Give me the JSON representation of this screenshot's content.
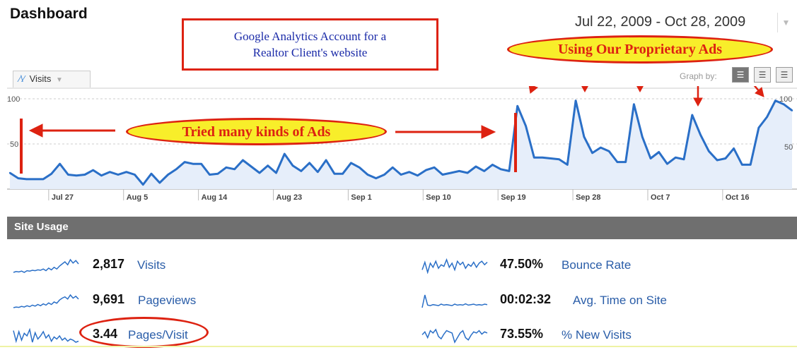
{
  "dashboard": {
    "title": "Dashboard",
    "date_range": "Jul 22, 2009 - Oct 28, 2009"
  },
  "annotations": {
    "callout_line1": "Google Analytics Account for a",
    "callout_line2": "Realtor Client's website",
    "ads_label": "Using Our Proprietary Ads",
    "tried_label": "Tried many kinds of Ads"
  },
  "graph": {
    "metric_tab": "Visits",
    "tab_icon": "line-chart-icon",
    "graph_by_label": "Graph by:",
    "graph_by_icons": [
      "day-icon",
      "week-icon",
      "month-icon"
    ],
    "y_max_label": "100",
    "y_mid_label": "50",
    "x_labels": [
      "Jul 27",
      "Aug 5",
      "Aug 14",
      "Aug 23",
      "Sep 1",
      "Sep 10",
      "Sep 19",
      "Sep 28",
      "Oct 7",
      "Oct 16"
    ]
  },
  "chart_data": {
    "type": "area",
    "series": [
      {
        "name": "Visits",
        "values": [
          18,
          12,
          11,
          11,
          11,
          17,
          28,
          16,
          15,
          16,
          21,
          15,
          19,
          16,
          19,
          16,
          5,
          17,
          7,
          16,
          22,
          30,
          28,
          28,
          16,
          17,
          24,
          22,
          32,
          25,
          18,
          26,
          18,
          39,
          26,
          20,
          29,
          19,
          32,
          17,
          17,
          29,
          24,
          16,
          12,
          16,
          24,
          16,
          19,
          15,
          21,
          24,
          16,
          18,
          20,
          18,
          25,
          20,
          27,
          22,
          20,
          92,
          70,
          35,
          35,
          34,
          33,
          27,
          98,
          58,
          40,
          46,
          42,
          30,
          30,
          94,
          58,
          34,
          41,
          28,
          35,
          33,
          82,
          60,
          42,
          32,
          34,
          45,
          27,
          27,
          68,
          80,
          98,
          94,
          87
        ],
        "color": "#2a6fc7",
        "fill": "#e6eefa"
      }
    ],
    "ylim": [
      0,
      100
    ],
    "grid": "horizontal dashed at 50 and 100"
  },
  "site_usage": {
    "header": "Site Usage",
    "metrics": [
      {
        "value": "2,817",
        "label": "Visits"
      },
      {
        "value": "9,691",
        "label": "Pageviews"
      },
      {
        "value": "3.44",
        "label": "Pages/Visit"
      },
      {
        "value": "47.50%",
        "label": "Bounce Rate"
      },
      {
        "value": "00:02:32",
        "label": "Avg. Time on Site"
      },
      {
        "value": "73.55%",
        "label": "% New Visits"
      }
    ],
    "sparklines": [
      [
        30,
        32,
        31,
        33,
        30,
        34,
        33,
        35,
        34,
        36,
        35,
        38,
        34,
        40,
        36,
        42,
        38,
        45,
        50,
        55,
        48,
        60,
        52,
        58,
        50
      ],
      [
        28,
        30,
        29,
        32,
        30,
        34,
        31,
        36,
        33,
        38,
        34,
        40,
        36,
        43,
        38,
        46,
        42,
        52,
        58,
        62,
        55,
        68,
        58,
        64,
        55
      ],
      [
        60,
        40,
        58,
        42,
        55,
        50,
        62,
        38,
        56,
        44,
        50,
        58,
        46,
        52,
        40,
        48,
        44,
        50,
        42,
        46,
        40,
        44,
        42,
        38,
        40
      ],
      [
        45,
        60,
        40,
        58,
        50,
        62,
        48,
        55,
        52,
        65,
        50,
        58,
        45,
        62,
        55,
        60,
        48,
        56,
        52,
        60,
        50,
        58,
        62,
        55,
        60
      ],
      [
        20,
        70,
        30,
        28,
        32,
        30,
        28,
        34,
        30,
        32,
        30,
        28,
        34,
        30,
        32,
        30,
        35,
        30,
        32,
        34,
        30,
        32,
        30,
        34,
        32
      ],
      [
        55,
        60,
        50,
        62,
        58,
        64,
        52,
        48,
        56,
        62,
        60,
        58,
        42,
        50,
        58,
        62,
        50,
        46,
        54,
        60,
        58,
        62,
        56,
        60,
        58
      ]
    ],
    "spark_color": "#2a6fc7"
  }
}
